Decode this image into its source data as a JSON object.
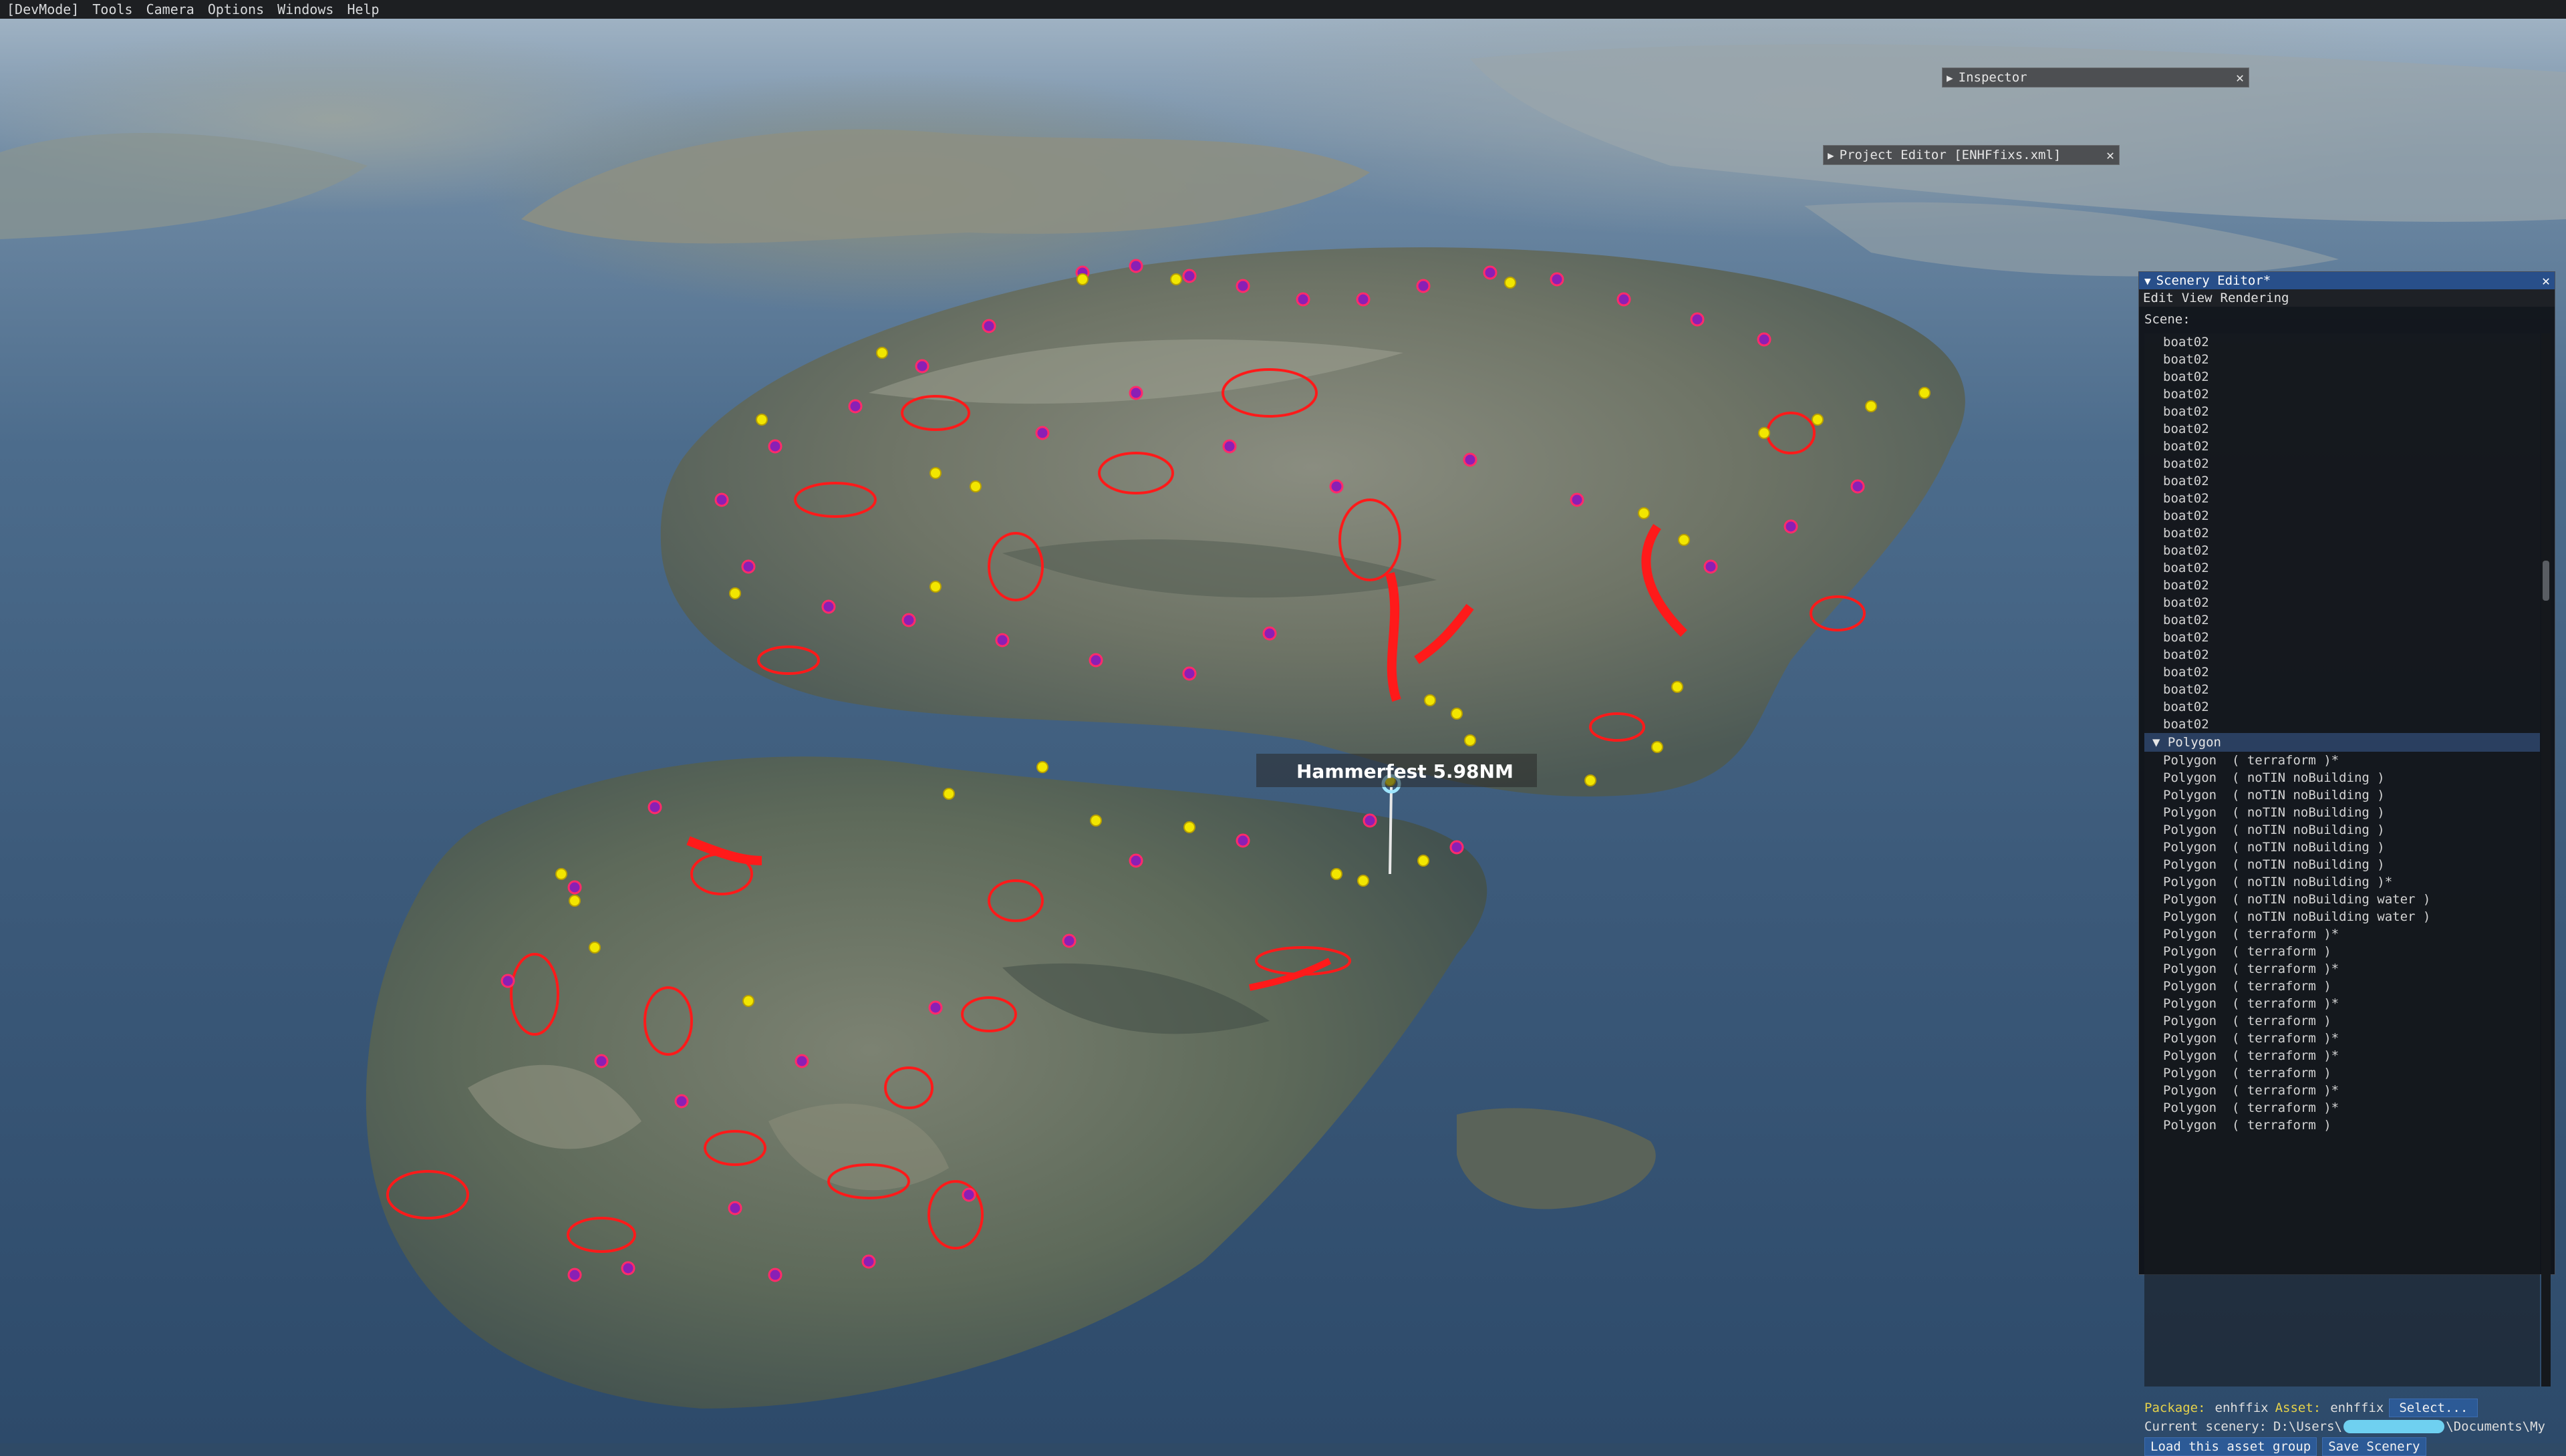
{
  "menubar": {
    "items": [
      "[DevMode]",
      "Tools",
      "Camera",
      "Options",
      "Windows",
      "Help"
    ]
  },
  "inspector": {
    "title": "Inspector",
    "close": "✕"
  },
  "project_editor": {
    "title": "Project Editor [ENHFfixs.xml]",
    "close": "✕"
  },
  "viewport": {
    "airport_label": "Hammerfest 5.98NM"
  },
  "scenery_editor": {
    "title": "Scenery Editor*",
    "close": "✕",
    "menu": [
      "Edit",
      "View",
      "Rendering"
    ],
    "scene_label": "Scene:",
    "boat_rows": [
      "boat02",
      "boat02",
      "boat02",
      "boat02",
      "boat02",
      "boat02",
      "boat02",
      "boat02",
      "boat02",
      "boat02",
      "boat02",
      "boat02",
      "boat02",
      "boat02",
      "boat02",
      "boat02",
      "boat02",
      "boat02",
      "boat02",
      "boat02",
      "boat02",
      "boat02",
      "boat02"
    ],
    "polygon_group": "Polygon",
    "polygon_rows": [
      "Polygon  ( terraform )*",
      "Polygon  ( noTIN noBuilding )",
      "Polygon  ( noTIN noBuilding )",
      "Polygon  ( noTIN noBuilding )",
      "Polygon  ( noTIN noBuilding )",
      "Polygon  ( noTIN noBuilding )",
      "Polygon  ( noTIN noBuilding )",
      "Polygon  ( noTIN noBuilding )*",
      "Polygon  ( noTIN noBuilding water )",
      "Polygon  ( noTIN noBuilding water )",
      "Polygon  ( terraform )*",
      "Polygon  ( terraform )",
      "Polygon  ( terraform )*",
      "Polygon  ( terraform )",
      "Polygon  ( terraform )*",
      "Polygon  ( terraform )",
      "Polygon  ( terraform )*",
      "Polygon  ( terraform )*",
      "Polygon  ( terraform )",
      "Polygon  ( terraform )*",
      "Polygon  ( terraform )*",
      "Polygon  ( terraform )"
    ],
    "footer": {
      "package_label": "Package:",
      "package_value": "enhffix",
      "asset_label": "Asset:",
      "asset_value": "enhffix",
      "select_button": "Select...",
      "current_scenery_label": "Current scenery:",
      "path_start": "D:\\Users\\",
      "path_end": "\\Documents\\My",
      "load_button": "Load this asset group",
      "save_button": "Save Scenery"
    }
  },
  "colors": {
    "polygon_outline": "#ff1a1a",
    "object_marker": "#8a1fb5",
    "spline_marker": "#f2e600",
    "title_bar": "#284f8a"
  }
}
